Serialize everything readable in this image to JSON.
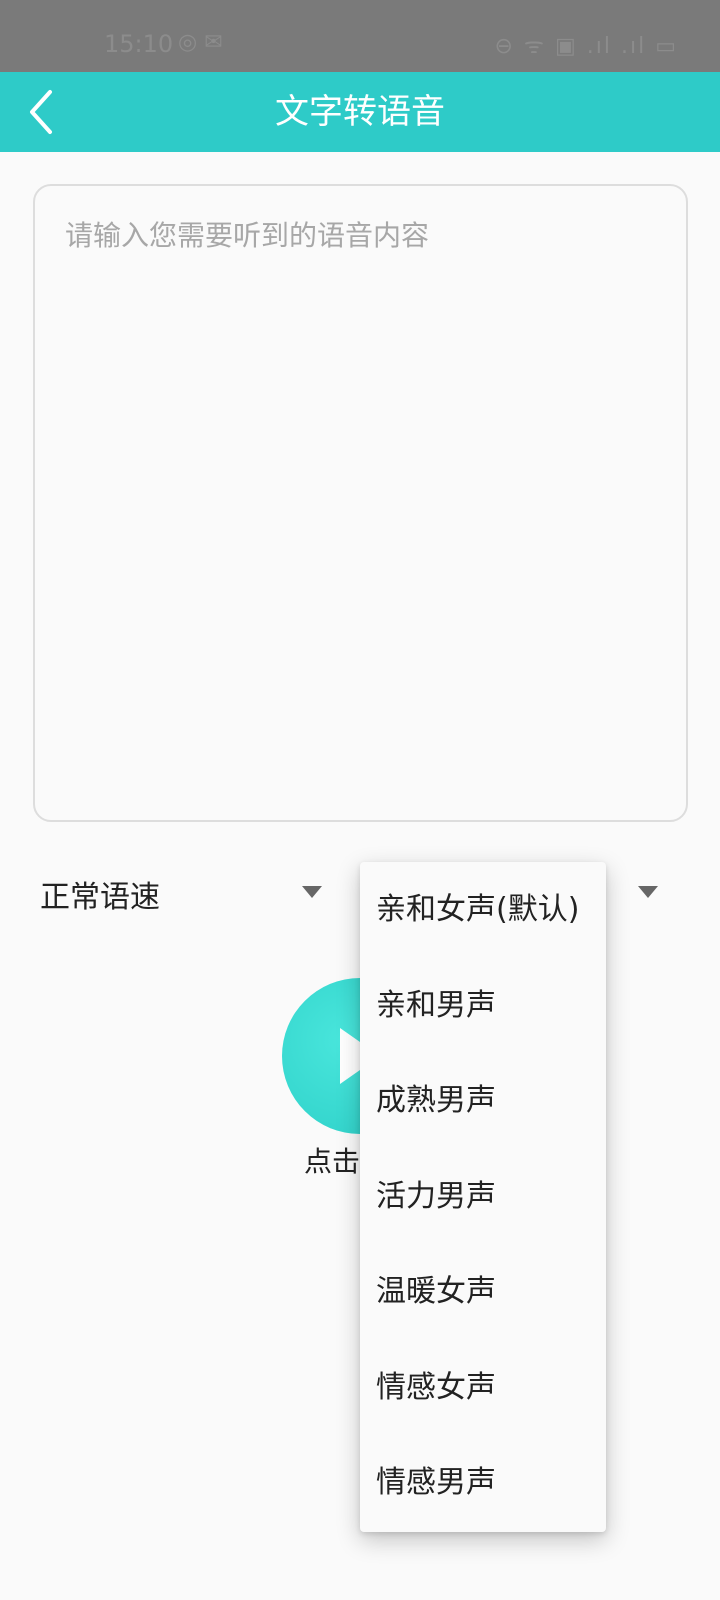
{
  "status_bar": {
    "time": "15:10",
    "left_icons": "◎ ✉",
    "right_icons": "⊖ ᯤ ▣ .ıl .ıl ▭"
  },
  "header": {
    "title": "文字转语音"
  },
  "editor": {
    "placeholder": "请输入您需要听到的语音内容"
  },
  "controls": {
    "speed_selected": "正常语速",
    "voice_selected": "",
    "play_caption": "点击"
  },
  "voice_menu": {
    "options": [
      "亲和女声(默认)",
      "亲和男声",
      "成熟男声",
      "活力男声",
      "温暖女声",
      "情感女声",
      "情感男声"
    ]
  },
  "colors": {
    "accent": "#2ecbc8",
    "status_bar": "#7a7a7a",
    "background": "#fafafa"
  },
  "icons": {
    "back": "chevron-left-icon",
    "dropdown": "triangle-down-icon",
    "play": "play-icon"
  }
}
